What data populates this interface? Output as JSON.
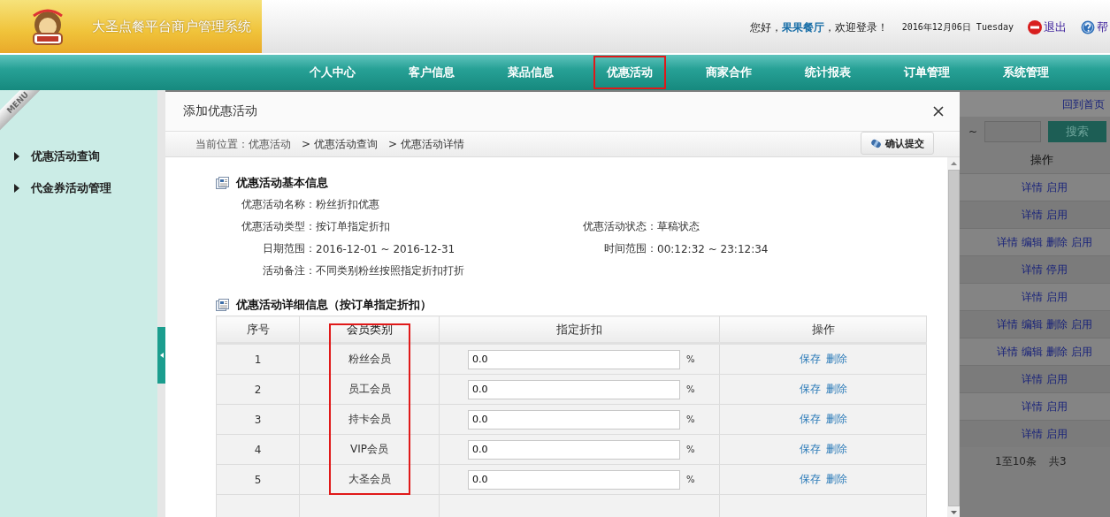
{
  "header": {
    "title": "大圣点餐平台商户管理系统",
    "greeting": {
      "prefix": "您好，",
      "name": "果果餐厅",
      "suffix": "，欢迎登录！"
    },
    "date": "2016年12月06日 Tuesday",
    "logout": "退出",
    "help": "帮"
  },
  "nav": [
    {
      "label": "个人中心",
      "selected": false
    },
    {
      "label": "客户信息",
      "selected": false
    },
    {
      "label": "菜品信息",
      "selected": false
    },
    {
      "label": "优惠活动",
      "selected": true
    },
    {
      "label": "商家合作",
      "selected": false
    },
    {
      "label": "统计报表",
      "selected": false
    },
    {
      "label": "订单管理",
      "selected": false
    },
    {
      "label": "系统管理",
      "selected": false
    }
  ],
  "sidebar": {
    "badge": "MENU",
    "items": [
      {
        "label": "优惠活动查询"
      },
      {
        "label": "代金券活动管理"
      }
    ]
  },
  "background": {
    "home_link": "回到首页",
    "range_separator": "~",
    "search_button": "搜索",
    "column": "操作",
    "rows": [
      {
        "actions": [
          "详情",
          "启用"
        ]
      },
      {
        "actions": [
          "详情",
          "启用"
        ]
      },
      {
        "actions": [
          "详情",
          "编辑",
          "删除",
          "启用"
        ]
      },
      {
        "actions": [
          "详情",
          "停用"
        ]
      },
      {
        "actions": [
          "详情",
          "启用"
        ]
      },
      {
        "actions": [
          "详情",
          "编辑",
          "删除",
          "启用"
        ]
      },
      {
        "actions": [
          "详情",
          "编辑",
          "删除",
          "启用"
        ]
      },
      {
        "actions": [
          "详情",
          "启用"
        ]
      },
      {
        "actions": [
          "详情",
          "启用"
        ]
      },
      {
        "actions": [
          "详情",
          "启用"
        ]
      }
    ],
    "pagination": [
      "1至10条",
      "共3"
    ]
  },
  "modal": {
    "title": "添加优惠活动",
    "breadcrumb": [
      "当前位置：优惠活动",
      "> 优惠活动查询",
      "> 优惠活动详情"
    ],
    "submit_button": "确认提交",
    "basic_info": {
      "title": "优惠活动基本信息",
      "rows": [
        [
          {
            "label": "优惠活动名称：",
            "value": "粉丝折扣优惠"
          }
        ],
        [
          {
            "label": "优惠活动类型：",
            "value": "按订单指定折扣"
          },
          {
            "label": "优惠活动状态：",
            "value": "草稿状态"
          }
        ],
        [
          {
            "label": "日期范围：",
            "value": "2016-12-01 ~ 2016-12-31"
          },
          {
            "label": "时间范围：",
            "value": "00:12:32 ~ 23:12:34"
          }
        ],
        [
          {
            "label": "活动备注：",
            "value": "不同类别粉丝按照指定折扣打折"
          }
        ]
      ]
    },
    "detail": {
      "title": "优惠活动详细信息（按订单指定折扣）",
      "columns": [
        {
          "label": "序号",
          "highlighted": false
        },
        {
          "label": "会员类别",
          "highlighted": true
        },
        {
          "label": "指定折扣",
          "highlighted": false
        },
        {
          "label": "操作",
          "highlighted": false
        }
      ],
      "rows": [
        {
          "index": "1",
          "member_type": "粉丝会员",
          "discount": "0.0",
          "unit": "%",
          "actions": [
            "保存",
            "删除"
          ]
        },
        {
          "index": "2",
          "member_type": "员工会员",
          "discount": "0.0",
          "unit": "%",
          "actions": [
            "保存",
            "删除"
          ]
        },
        {
          "index": "3",
          "member_type": "持卡会员",
          "discount": "0.0",
          "unit": "%",
          "actions": [
            "保存",
            "删除"
          ]
        },
        {
          "index": "4",
          "member_type": "VIP会员",
          "discount": "0.0",
          "unit": "%",
          "actions": [
            "保存",
            "删除"
          ]
        },
        {
          "index": "5",
          "member_type": "大圣会员",
          "discount": "0.0",
          "unit": "%",
          "actions": [
            "保存",
            "删除"
          ]
        }
      ]
    }
  }
}
